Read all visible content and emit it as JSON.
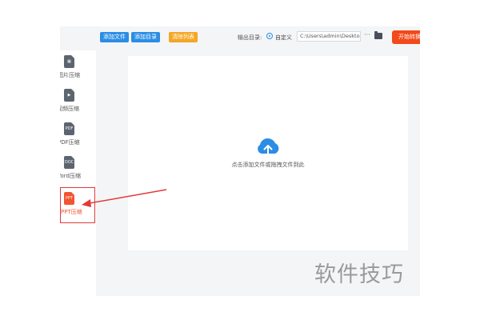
{
  "toolbar": {
    "add_file": "添加文件",
    "add_dir": "添加目录",
    "clear_list": "清除列表",
    "output_label": "输出目录:",
    "radio_label": "自定义",
    "path_value": "C:\\Users\\admin\\Deskto",
    "more": "···",
    "start": "开始转换"
  },
  "sidebar": {
    "items": [
      {
        "label": "图片压缩",
        "glyph": "▦"
      },
      {
        "label": "视频压缩",
        "glyph": "▶"
      },
      {
        "label": "PDF压缩",
        "glyph": "PDF"
      },
      {
        "label": "Word压缩",
        "glyph": "DOC"
      },
      {
        "label": "PPT压缩",
        "glyph": "PPT"
      }
    ]
  },
  "dropzone": {
    "hint": "点击添加文件或拖拽文件到此"
  },
  "watermark": "软件技巧",
  "colors": {
    "accent_blue": "#2b8de5",
    "accent_orange": "#f5a623",
    "start_red": "#f24a1a",
    "active_red": "#f2542f",
    "highlight_red": "#e23a3a"
  }
}
